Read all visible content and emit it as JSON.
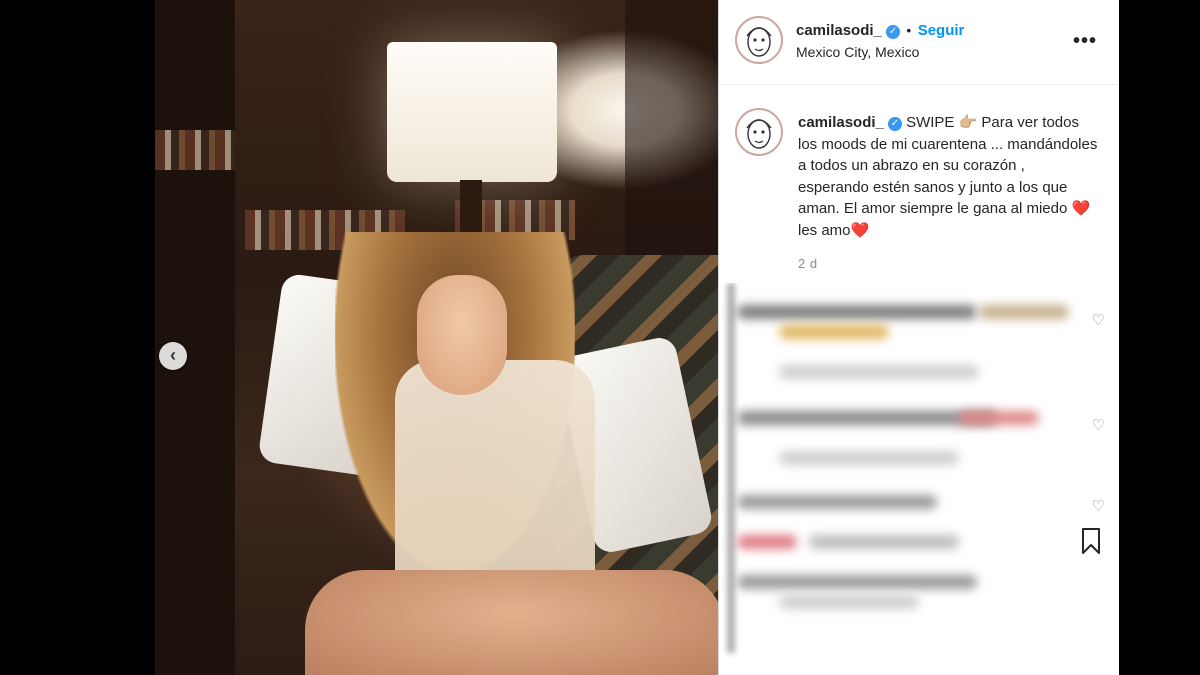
{
  "post": {
    "username": "camilasodi_",
    "follow_separator": "•",
    "follow_label": "Seguir",
    "location": "Mexico City, Mexico",
    "more_label": "•••",
    "caption_username": "camilasodi_",
    "caption_text": "SWIPE 👉🏼 Para ver todos los moods de mi cuarentena ... mandándoles a todos un abrazo en su corazón , esperando estén sanos y junto a los que aman. El amor siempre le gana al miedo ❤️ les amo❤️",
    "timestamp": "2 d",
    "prev_arrow": "‹",
    "heart_icon": "♡"
  },
  "colors": {
    "accent": "#0095f6",
    "verified": "#3897f0",
    "text": "#262626",
    "muted": "#8e8e8e"
  },
  "icons": [
    "verified-badge-icon",
    "more-options-icon",
    "chevron-left-icon",
    "heart-icon",
    "bookmark-icon"
  ]
}
